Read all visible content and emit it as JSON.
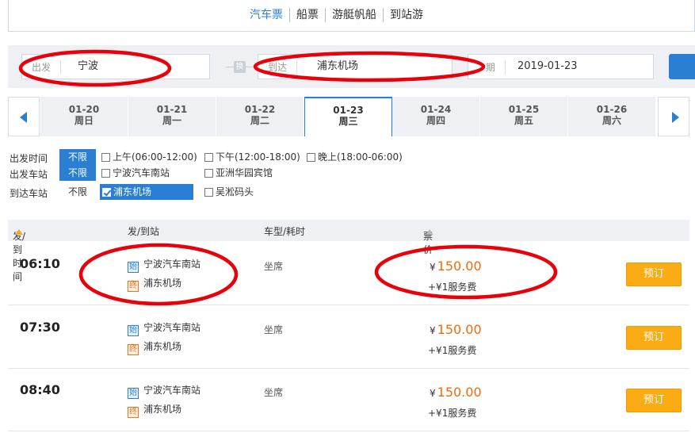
{
  "top_tabs": [
    "汽车票",
    "船票",
    "游艇帆船",
    "到站游"
  ],
  "search": {
    "from_label": "出发",
    "from_value": "宁波",
    "swap_label": "换",
    "to_label": "到达",
    "to_value": "浦东机场",
    "date_label": "期",
    "date_value": "2019-01-23"
  },
  "dates": [
    {
      "date": "01-20",
      "weekday": "周日"
    },
    {
      "date": "01-21",
      "weekday": "周一"
    },
    {
      "date": "01-22",
      "weekday": "周二"
    },
    {
      "date": "01-23",
      "weekday": "周三"
    },
    {
      "date": "01-24",
      "weekday": "周四"
    },
    {
      "date": "01-25",
      "weekday": "周五"
    },
    {
      "date": "01-26",
      "weekday": "周六"
    }
  ],
  "filters": {
    "depart_time": {
      "label": "出发时间",
      "all": "不限",
      "options": [
        "上午(06:00-12:00)",
        "下午(12:00-18:00)",
        "晚上(18:00-06:00)"
      ]
    },
    "depart_station": {
      "label": "出发车站",
      "all": "不限",
      "options": [
        "宁波汽车南站",
        "亚洲华园宾馆"
      ]
    },
    "arrive_station": {
      "label": "到达车站",
      "all": "不限",
      "options": [
        "浦东机场",
        "吴淞码头"
      ]
    }
  },
  "table": {
    "headers": [
      "发/到时间",
      "发/到站",
      "车型/耗时",
      "票价"
    ],
    "start_tag": "始",
    "end_tag": "终",
    "book_label": "预订",
    "rows": [
      {
        "time": "06:10",
        "from": "宁波汽车南站",
        "to": "浦东机场",
        "seat": "坐席",
        "currency": "¥",
        "price": "150.00",
        "fee": "+¥1服务费"
      },
      {
        "time": "07:30",
        "from": "宁波汽车南站",
        "to": "浦东机场",
        "seat": "坐席",
        "currency": "¥",
        "price": "150.00",
        "fee": "+¥1服务费"
      },
      {
        "time": "08:40",
        "from": "宁波汽车南站",
        "to": "浦东机场",
        "seat": "坐席",
        "currency": "¥",
        "price": "150.00",
        "fee": "+¥1服务费"
      }
    ]
  },
  "colors": {
    "accent": "#2a7fd4",
    "price": "#f06b0f",
    "book_button": "#fbac15",
    "annotation": "#e8000b"
  }
}
